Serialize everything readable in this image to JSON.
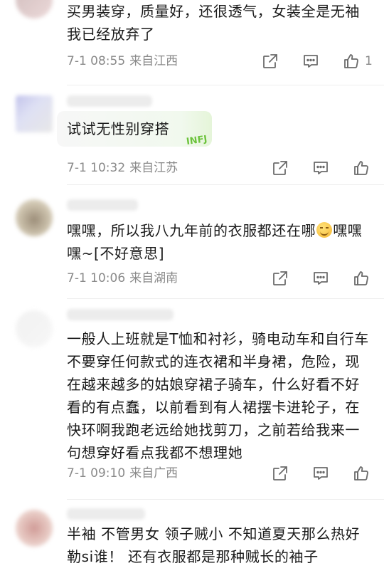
{
  "comments": [
    {
      "text": "买男装穿，质量好，还很透气，女装全是无袖我已经放弃了",
      "time": "7-1 08:55",
      "location": "来自江西",
      "like_count": "1"
    },
    {
      "text": "试试无性别穿搭",
      "badge": "INFJ",
      "time": "7-1 10:32",
      "location": "来自江苏"
    },
    {
      "text_before_emoji": "嘿嘿，所以我八九年前的衣服都还在哪",
      "emoji": "[笑脸]",
      "text_after_emoji": "嘿嘿嘿~[不好意思]",
      "time": "7-1 10:06",
      "location": "来自湖南"
    },
    {
      "text": "一般人上班就是T恤和衬衫，骑电动车和自行车不要穿任何款式的连衣裙和半身裙，危险，现在越来越多的姑娘穿裙子骑车，什么好看不好看的有点蠢，以前看到有人裙摆卡进轮子，在快环啊我跑老远给她找剪刀，之前若给我来一句想穿好看点我都不想理她",
      "time": "7-1 09:10",
      "location": "来自广西"
    },
    {
      "text": "半袖 不管男女 领子贼小 不知道夏天那么热好勒si谁！ 还有衣服都是那种贼长的袖子"
    }
  ],
  "icons": {
    "share": "share-icon",
    "comment": "comment-icon",
    "like": "thumbs-up-icon"
  },
  "colors": {
    "text": "#1a1a1a",
    "meta": "#8a8a8a",
    "icon": "#6b6b6b",
    "badge": "#6cc33b"
  }
}
